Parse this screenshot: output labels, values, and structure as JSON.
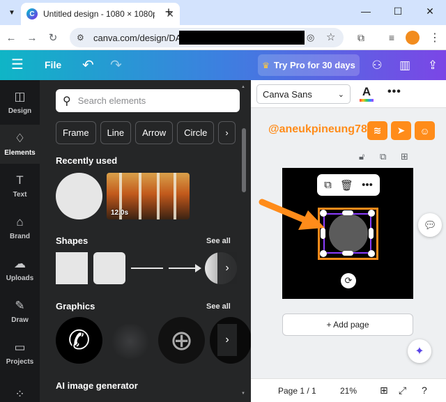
{
  "browser": {
    "tab_title": "Untitled design - 1080 × 1080p",
    "tab_list_icon": "chevron-down-icon",
    "new_tab": "+",
    "url": "canva.com/design/DAG",
    "window": {
      "minimize": "—",
      "maximize": "☐",
      "close": "✕"
    }
  },
  "canva_header": {
    "file_label": "File",
    "try_pro_label": "Try Pro for 30 days",
    "brand_colors": {
      "gradient_start": "#0fb5c6",
      "gradient_end": "#7b46e6"
    }
  },
  "rail": {
    "items": [
      {
        "label": "Design",
        "icon": "design-icon"
      },
      {
        "label": "Elements",
        "icon": "elements-icon",
        "active": true
      },
      {
        "label": "Text",
        "icon": "text-icon"
      },
      {
        "label": "Brand",
        "icon": "brand-icon"
      },
      {
        "label": "Uploads",
        "icon": "uploads-icon"
      },
      {
        "label": "Draw",
        "icon": "draw-icon"
      },
      {
        "label": "Projects",
        "icon": "projects-icon"
      }
    ]
  },
  "elements_panel": {
    "search_placeholder": "Search elements",
    "chips": [
      "Frame",
      "Line",
      "Arrow",
      "Circle"
    ],
    "recently_used_title": "Recently used",
    "video_duration": "12.0s",
    "shapes_title": "Shapes",
    "graphics_title": "Graphics",
    "see_all": "See all",
    "ai_title": "AI image generator"
  },
  "props_bar": {
    "font_name": "Canva Sans",
    "text_color_glyph": "A"
  },
  "canvas": {
    "watermark_text": "@aneukpineung78",
    "add_page_label": "+ Add page",
    "accent_orange": "#ff8c1a",
    "selection_purple": "#8b3dff"
  },
  "footer": {
    "page_indicator": "Page 1 / 1",
    "zoom": "21%"
  }
}
